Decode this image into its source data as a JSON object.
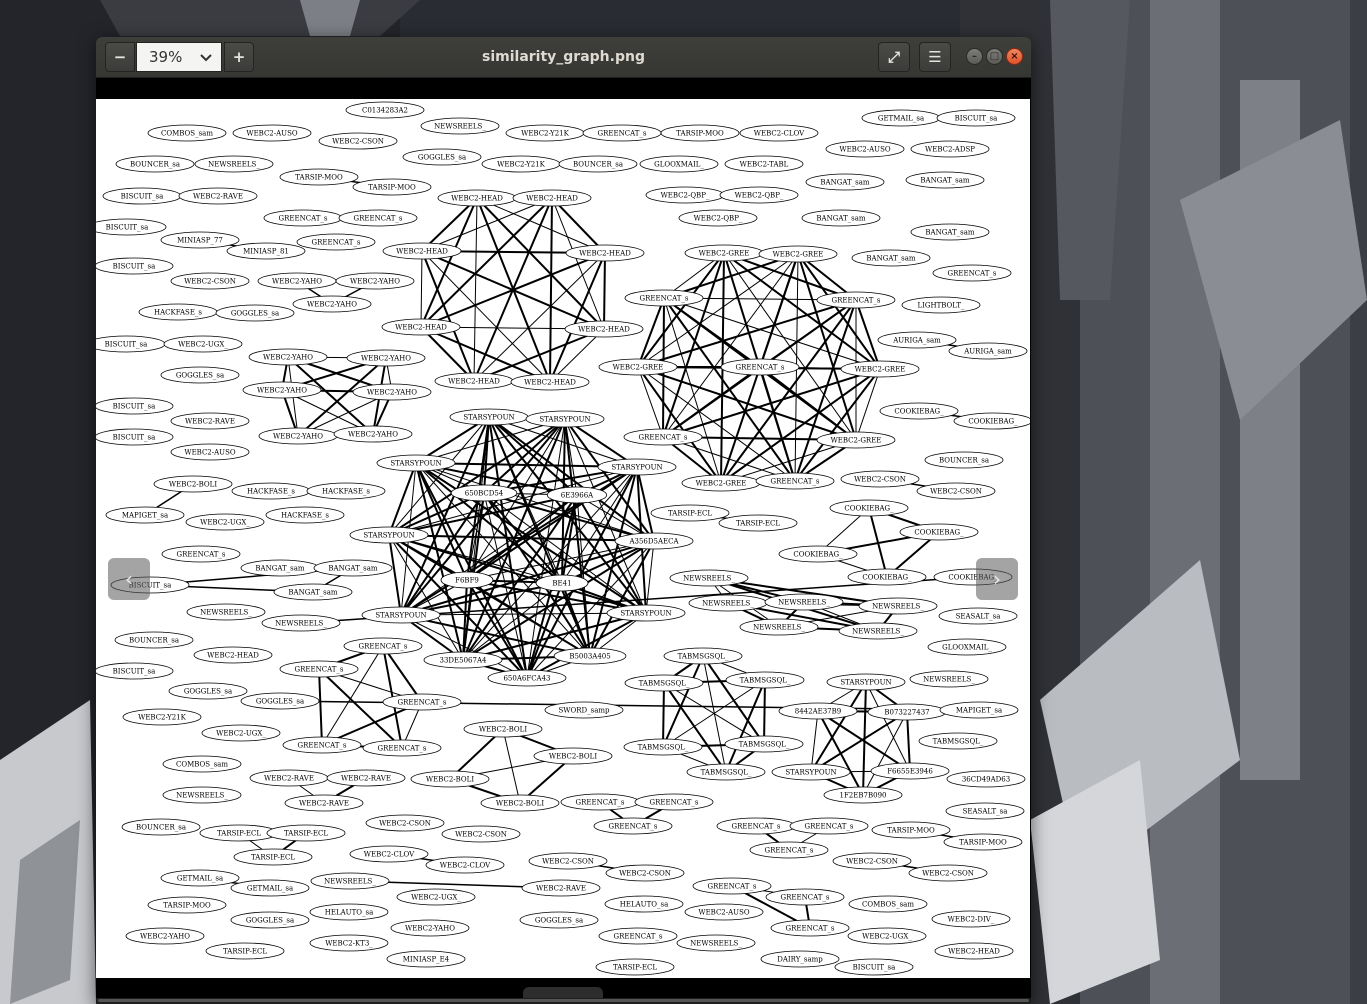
{
  "window": {
    "title": "similarity_graph.png",
    "zoom_value": "39%"
  },
  "toolbar": {
    "zoom_out_label": "−",
    "zoom_in_label": "+",
    "dropdown_glyph": "⌄",
    "fullscreen_glyph": "⤢",
    "menu_glyph": "☰",
    "minimize_glyph": "–",
    "maximize_glyph": "□",
    "close_glyph": "×"
  },
  "overlay": {
    "prev_glyph": "‹",
    "next_glyph": "›",
    "rotate_left_glyph": "↶",
    "rotate_right_glyph": "↷"
  },
  "icons": [
    "zoom-out-icon",
    "chevron-down-icon",
    "zoom-in-icon",
    "fullscreen-icon",
    "hamburger-menu-icon",
    "minimize-icon",
    "maximize-icon",
    "close-icon",
    "chevron-left-icon",
    "chevron-right-icon",
    "rotate-left-icon",
    "rotate-right-icon"
  ],
  "colors": {
    "close": "#e0522a",
    "headerbar": "#3a3a37",
    "image_bg": "#ffffff"
  },
  "graph": {
    "nodes": [
      [
        "C0134283A2",
        385,
        110
      ],
      [
        "NEWSREELS_",
        460,
        126
      ],
      [
        "COMBOS_sam",
        187,
        133
      ],
      [
        "WEBC2-AUSO",
        272,
        133
      ],
      [
        "WEBC2-Y21K",
        545,
        133
      ],
      [
        "GREENCAT_s",
        622,
        133
      ],
      [
        "TARSIP-MOO",
        700,
        133
      ],
      [
        "WEBC2-CLOV",
        779,
        133
      ],
      [
        "GETMAIL_sa",
        901,
        118
      ],
      [
        "BISCUIT_sa",
        976,
        118
      ],
      [
        "WEBC2-CSON",
        358,
        141
      ],
      [
        "BOUNCER_sa",
        155,
        164
      ],
      [
        "NEWSREELS_",
        234,
        164
      ],
      [
        "GOGGLES_sa",
        442,
        157
      ],
      [
        "WEBC2-Y21K",
        521,
        164
      ],
      [
        "BOUNCER_sa",
        598,
        164
      ],
      [
        "GLOOXMAIL_",
        679,
        164
      ],
      [
        "WEBC2-TABL",
        764,
        164
      ],
      [
        "WEBC2-AUSO",
        865,
        149
      ],
      [
        "WEBC2-ADSP",
        950,
        149
      ],
      [
        "TARSIP-MOO",
        319,
        177
      ],
      [
        "TARSIP-MOO",
        392,
        187
      ],
      [
        "BISCUIT_sa",
        142,
        196
      ],
      [
        "WEBC2-RAVE",
        218,
        196
      ],
      [
        "WEBC2-QBP_",
        685,
        195
      ],
      [
        "WEBC2-QBP_",
        759,
        195
      ],
      [
        "WEBC2-QBP_",
        718,
        218
      ],
      [
        "BANGAT_sam",
        845,
        182
      ],
      [
        "BANGAT_sam",
        945,
        180
      ],
      [
        "GREENCAT_s",
        303,
        218
      ],
      [
        "GREENCAT_s",
        378,
        218
      ],
      [
        "GREENCAT_s",
        336,
        242
      ],
      [
        "BISCUIT_sa",
        127,
        227
      ],
      [
        "MINIASP_77",
        200,
        240
      ],
      [
        "MINIASP_81",
        266,
        251
      ],
      [
        "BANGAT_sam",
        841,
        218
      ],
      [
        "BANGAT_sam",
        950,
        232
      ],
      [
        "BANGAT_sam",
        891,
        258
      ],
      [
        "BISCUIT_sa",
        134,
        266
      ],
      [
        "WEBC2-CSON",
        210,
        281
      ],
      [
        "WEBC2-YAHO",
        297,
        281
      ],
      [
        "WEBC2-YAHO",
        375,
        281
      ],
      [
        "WEBC2-YAHO",
        332,
        304
      ],
      [
        "GREENCAT_s",
        972,
        273
      ],
      [
        "HACKFASE_s",
        178,
        312
      ],
      [
        "GOGGLES_sa",
        255,
        313
      ],
      [
        "LIGHTBOLT_",
        941,
        305
      ],
      [
        "BISCUIT_sa",
        126,
        344
      ],
      [
        "WEBC2-UGX_",
        203,
        344
      ],
      [
        "AURIGA_sam",
        917,
        340
      ],
      [
        "AURIGA_sam",
        988,
        351
      ],
      [
        "GOGGLES_sa",
        200,
        375
      ],
      [
        "BISCUIT_sa",
        134,
        406
      ],
      [
        "WEBC2-RAVE",
        210,
        421
      ],
      [
        "COOKIEBAG_",
        919,
        411
      ],
      [
        "COOKIEBAG_",
        993,
        421
      ],
      [
        "BISCUIT_sa",
        134,
        437
      ],
      [
        "WEBC2-AUSO",
        210,
        452
      ],
      [
        "BOUNCER_sa",
        964,
        460
      ],
      [
        "WEBC2-BOLI",
        193,
        484
      ],
      [
        "HACKFASE_s",
        271,
        491
      ],
      [
        "HACKFASE_s",
        346,
        491
      ],
      [
        "WEBC2-CSON",
        880,
        479
      ],
      [
        "WEBC2-CSON",
        956,
        491
      ],
      [
        "MAPIGET_sa",
        145,
        515
      ],
      [
        "HACKFASE_s",
        305,
        515
      ],
      [
        "WEBC2-UGX_",
        225,
        522
      ],
      [
        "TARSIP-ECL",
        690,
        513
      ],
      [
        "TARSIP-ECL",
        758,
        523
      ],
      [
        "GREENCAT_s",
        201,
        554
      ],
      [
        "BANGAT_sam",
        280,
        568
      ],
      [
        "BANGAT_sam",
        353,
        568
      ],
      [
        "BANGAT_sam",
        313,
        592
      ],
      [
        "BISCUIT_sa",
        150,
        585
      ],
      [
        "NEWSREELS_",
        226,
        612
      ],
      [
        "NEWSREELS_",
        301,
        623
      ],
      [
        "COOKIEBAG_",
        973,
        577
      ],
      [
        "SEASALT_sa",
        978,
        616
      ],
      [
        "BOUNCER_sa",
        154,
        640
      ],
      [
        "WEBC2-HEAD",
        233,
        655
      ],
      [
        "GLOOXMAIL_",
        967,
        647
      ],
      [
        "BISCUIT_sa",
        134,
        671
      ],
      [
        "NEWSREELS_",
        949,
        679
      ],
      [
        "GOGGLES_sa",
        208,
        691
      ],
      [
        "GOGGLES_sa",
        280,
        701
      ],
      [
        "MAPIGET_sa",
        979,
        710
      ],
      [
        "WEBC2-Y21K",
        162,
        717
      ],
      [
        "WEBC2-UGX_",
        241,
        733
      ],
      [
        "SWORD_samp",
        584,
        710
      ],
      [
        "TABMSGSQL_",
        958,
        741
      ],
      [
        "COMBOS_sam",
        202,
        764
      ],
      [
        "36CD49AD63",
        986,
        779
      ],
      [
        "NEWSREELS_",
        202,
        795
      ],
      [
        "SEASALT_sa",
        985,
        811
      ],
      [
        "BOUNCER_sa",
        161,
        827
      ],
      [
        "WEBC2-CSON",
        405,
        823
      ],
      [
        "WEBC2-CSON",
        481,
        834
      ],
      [
        "TARSIP-MOO",
        911,
        830
      ],
      [
        "TARSIP-MOO",
        983,
        842
      ],
      [
        "WEBC2-CLOV",
        389,
        854
      ],
      [
        "WEBC2-CLOV",
        465,
        865
      ],
      [
        "WEBC2-CSON",
        568,
        861
      ],
      [
        "WEBC2-CSON",
        645,
        873
      ],
      [
        "WEBC2-CSON",
        872,
        861
      ],
      [
        "WEBC2-CSON",
        948,
        873
      ],
      [
        "GETMAIL_sa",
        200,
        878
      ],
      [
        "GETMAIL_sa",
        270,
        888
      ],
      [
        "NEWSREELS_",
        350,
        881
      ],
      [
        "WEBC2-RAVE",
        561,
        888
      ],
      [
        "TARSIP-MOO",
        187,
        905
      ],
      [
        "HELAUTO_sa",
        349,
        912
      ],
      [
        "WEBC2-UGX_",
        436,
        897
      ],
      [
        "HELAUTO_sa",
        644,
        904
      ],
      [
        "WEBC2-AUSO",
        724,
        912
      ],
      [
        "COMBOS_sam",
        888,
        904
      ],
      [
        "GOGGLES_sa",
        270,
        920
      ],
      [
        "WEBC2-YAHO",
        430,
        928
      ],
      [
        "GOGGLES_sa",
        559,
        920
      ],
      [
        "WEBC2-DIV_",
        971,
        919
      ],
      [
        "WEBC2-YAHO",
        165,
        936
      ],
      [
        "WEBC2-KT3_",
        349,
        943
      ],
      [
        "GREENCAT_s",
        638,
        936
      ],
      [
        "NEWSREELS_",
        716,
        943
      ],
      [
        "WEBC2-UGX_",
        887,
        936
      ],
      [
        "TARSIP-ECL",
        245,
        951
      ],
      [
        "WEBC2-HEAD",
        974,
        951
      ],
      [
        "MINIASP_E4",
        426,
        959
      ],
      [
        "DAIRY_samp",
        800,
        959
      ],
      [
        "BISCUIT_sa",
        874,
        967
      ],
      [
        "TARSIP-ECL",
        635,
        967
      ]
    ],
    "clusters": [
      [
        [
          "WEBC2-HEAD",
          477,
          198
        ],
        [
          "WEBC2-HEAD",
          552,
          198
        ],
        [
          "WEBC2-HEAD",
          422,
          251
        ],
        [
          "WEBC2-HEAD",
          605,
          253
        ],
        [
          "WEBC2-HEAD",
          421,
          327
        ],
        [
          "WEBC2-HEAD",
          604,
          329
        ],
        [
          "WEBC2-HEAD",
          474,
          381
        ],
        [
          "WEBC2-HEAD",
          550,
          382
        ]
      ],
      [
        [
          "WEBC2-GREE",
          724,
          253
        ],
        [
          "WEBC2-GREE",
          798,
          254
        ],
        [
          "GREENCAT_s",
          664,
          298
        ],
        [
          "GREENCAT_s",
          856,
          300
        ],
        [
          "WEBC2-GREE",
          638,
          367
        ],
        [
          "GREENCAT_s",
          760,
          367
        ],
        [
          "WEBC2-GREE",
          880,
          369
        ],
        [
          "GREENCAT_s",
          663,
          437
        ],
        [
          "WEBC2-GREE",
          856,
          440
        ],
        [
          "WEBC2-GREE",
          721,
          483
        ],
        [
          "GREENCAT_s",
          795,
          481
        ]
      ],
      [
        [
          "WEBC2-YAHO",
          288,
          357
        ],
        [
          "WEBC2-YAHO",
          386,
          358
        ],
        [
          "WEBC2-YAHO",
          282,
          390
        ],
        [
          "WEBC2-YAHO",
          392,
          392
        ],
        [
          "WEBC2-YAHO",
          298,
          436
        ],
        [
          "WEBC2-YAHO",
          373,
          434
        ]
      ],
      [
        [
          "STARSYPOUN",
          489,
          417
        ],
        [
          "STARSYPOUN",
          565,
          419
        ],
        [
          "STARSYPOUN",
          416,
          463
        ],
        [
          "STARSYPOUN",
          637,
          467
        ],
        [
          "650BCD54",
          484,
          493
        ],
        [
          "6E3966A",
          577,
          495
        ],
        [
          "STARSYPOUN",
          389,
          535
        ],
        [
          "A356D5AECA",
          654,
          541
        ],
        [
          "F6BF9",
          467,
          580
        ],
        [
          "BE41",
          562,
          583
        ],
        [
          "STARSYPOUN",
          401,
          615
        ],
        [
          "STARSYPOUN",
          646,
          613
        ],
        [
          "33DE5067A4",
          463,
          660
        ],
        [
          "B5003A405",
          590,
          656
        ],
        [
          "650A6FCA43",
          527,
          678
        ]
      ],
      [
        [
          "COOKIEBAG_",
          869,
          508
        ],
        [
          "COOKIEBAG_",
          939,
          532
        ],
        [
          "COOKIEBAG_",
          818,
          554
        ],
        [
          "COOKIEBAG_",
          887,
          577
        ]
      ],
      [
        [
          "NEWSREELS_",
          709,
          578
        ],
        [
          "NEWSREELS_",
          728,
          603
        ],
        [
          "NEWSREELS_",
          804,
          602
        ],
        [
          "NEWSREELS_",
          898,
          606
        ],
        [
          "NEWSREELS_",
          779,
          627
        ],
        [
          "NEWSREELS_",
          878,
          631
        ]
      ],
      [
        [
          "GREENCAT_s",
          383,
          646
        ],
        [
          "GREENCAT_s",
          319,
          669
        ],
        [
          "GREENCAT_s",
          422,
          702
        ],
        [
          "GREENCAT_s",
          322,
          745
        ],
        [
          "GREENCAT_s",
          402,
          748
        ]
      ],
      [
        [
          "TABMSGSQL_",
          703,
          656
        ],
        [
          "TABMSGSQL_",
          664,
          683
        ],
        [
          "TABMSGSQL_",
          765,
          680
        ],
        [
          "TABMSGSQL_",
          663,
          747
        ],
        [
          "TABMSGSQL_",
          764,
          744
        ],
        [
          "TABMSGSQL_",
          726,
          772
        ]
      ],
      [
        [
          "STARSYPOUN",
          866,
          682
        ],
        [
          "8442AE37B9",
          818,
          711
        ],
        [
          "B073227437",
          907,
          712
        ],
        [
          "STARSYPOUN",
          811,
          772
        ],
        [
          "F6655E3946",
          910,
          771
        ],
        [
          "1F2EB7B090",
          863,
          795
        ]
      ],
      [
        [
          "WEBC2-BOLI",
          503,
          729
        ],
        [
          "WEBC2-BOLI",
          573,
          756
        ],
        [
          "WEBC2-BOLI",
          450,
          779
        ],
        [
          "WEBC2-BOLI",
          520,
          803
        ]
      ],
      [
        [
          "WEBC2-RAVE",
          289,
          778
        ],
        [
          "WEBC2-RAVE",
          366,
          778
        ],
        [
          "WEBC2-RAVE",
          324,
          803
        ]
      ],
      [
        [
          "GREENCAT_s",
          600,
          802
        ],
        [
          "GREENCAT_s",
          674,
          802
        ],
        [
          "GREENCAT_s",
          633,
          826
        ]
      ],
      [
        [
          "GREENCAT_s",
          756,
          826
        ],
        [
          "GREENCAT_s",
          829,
          826
        ],
        [
          "GREENCAT_s",
          789,
          850
        ]
      ],
      [
        [
          "TARSIP-ECL",
          239,
          833
        ],
        [
          "TARSIP-ECL",
          306,
          833
        ],
        [
          "TARSIP-ECL",
          273,
          857
        ]
      ],
      [
        [
          "GREENCAT_s",
          732,
          886
        ],
        [
          "GREENCAT_s",
          805,
          897
        ],
        [
          "GREENCAT_s",
          810,
          928
        ]
      ]
    ],
    "pairs": [
      [
        20,
        21
      ],
      [
        33,
        34
      ],
      [
        40,
        41
      ],
      [
        40,
        42
      ],
      [
        41,
        42
      ],
      [
        44,
        45
      ],
      [
        49,
        50
      ],
      [
        54,
        55
      ],
      [
        60,
        61
      ],
      [
        62,
        63
      ],
      [
        59,
        64
      ],
      [
        67,
        68
      ],
      [
        71,
        72
      ],
      [
        71,
        73
      ],
      [
        72,
        73
      ],
      [
        75,
        76
      ],
      [
        84,
        85
      ],
      [
        97,
        98
      ],
      [
        99,
        100
      ],
      [
        101,
        102
      ],
      [
        103,
        104
      ],
      [
        105,
        106
      ],
      [
        107,
        108
      ]
    ]
  }
}
